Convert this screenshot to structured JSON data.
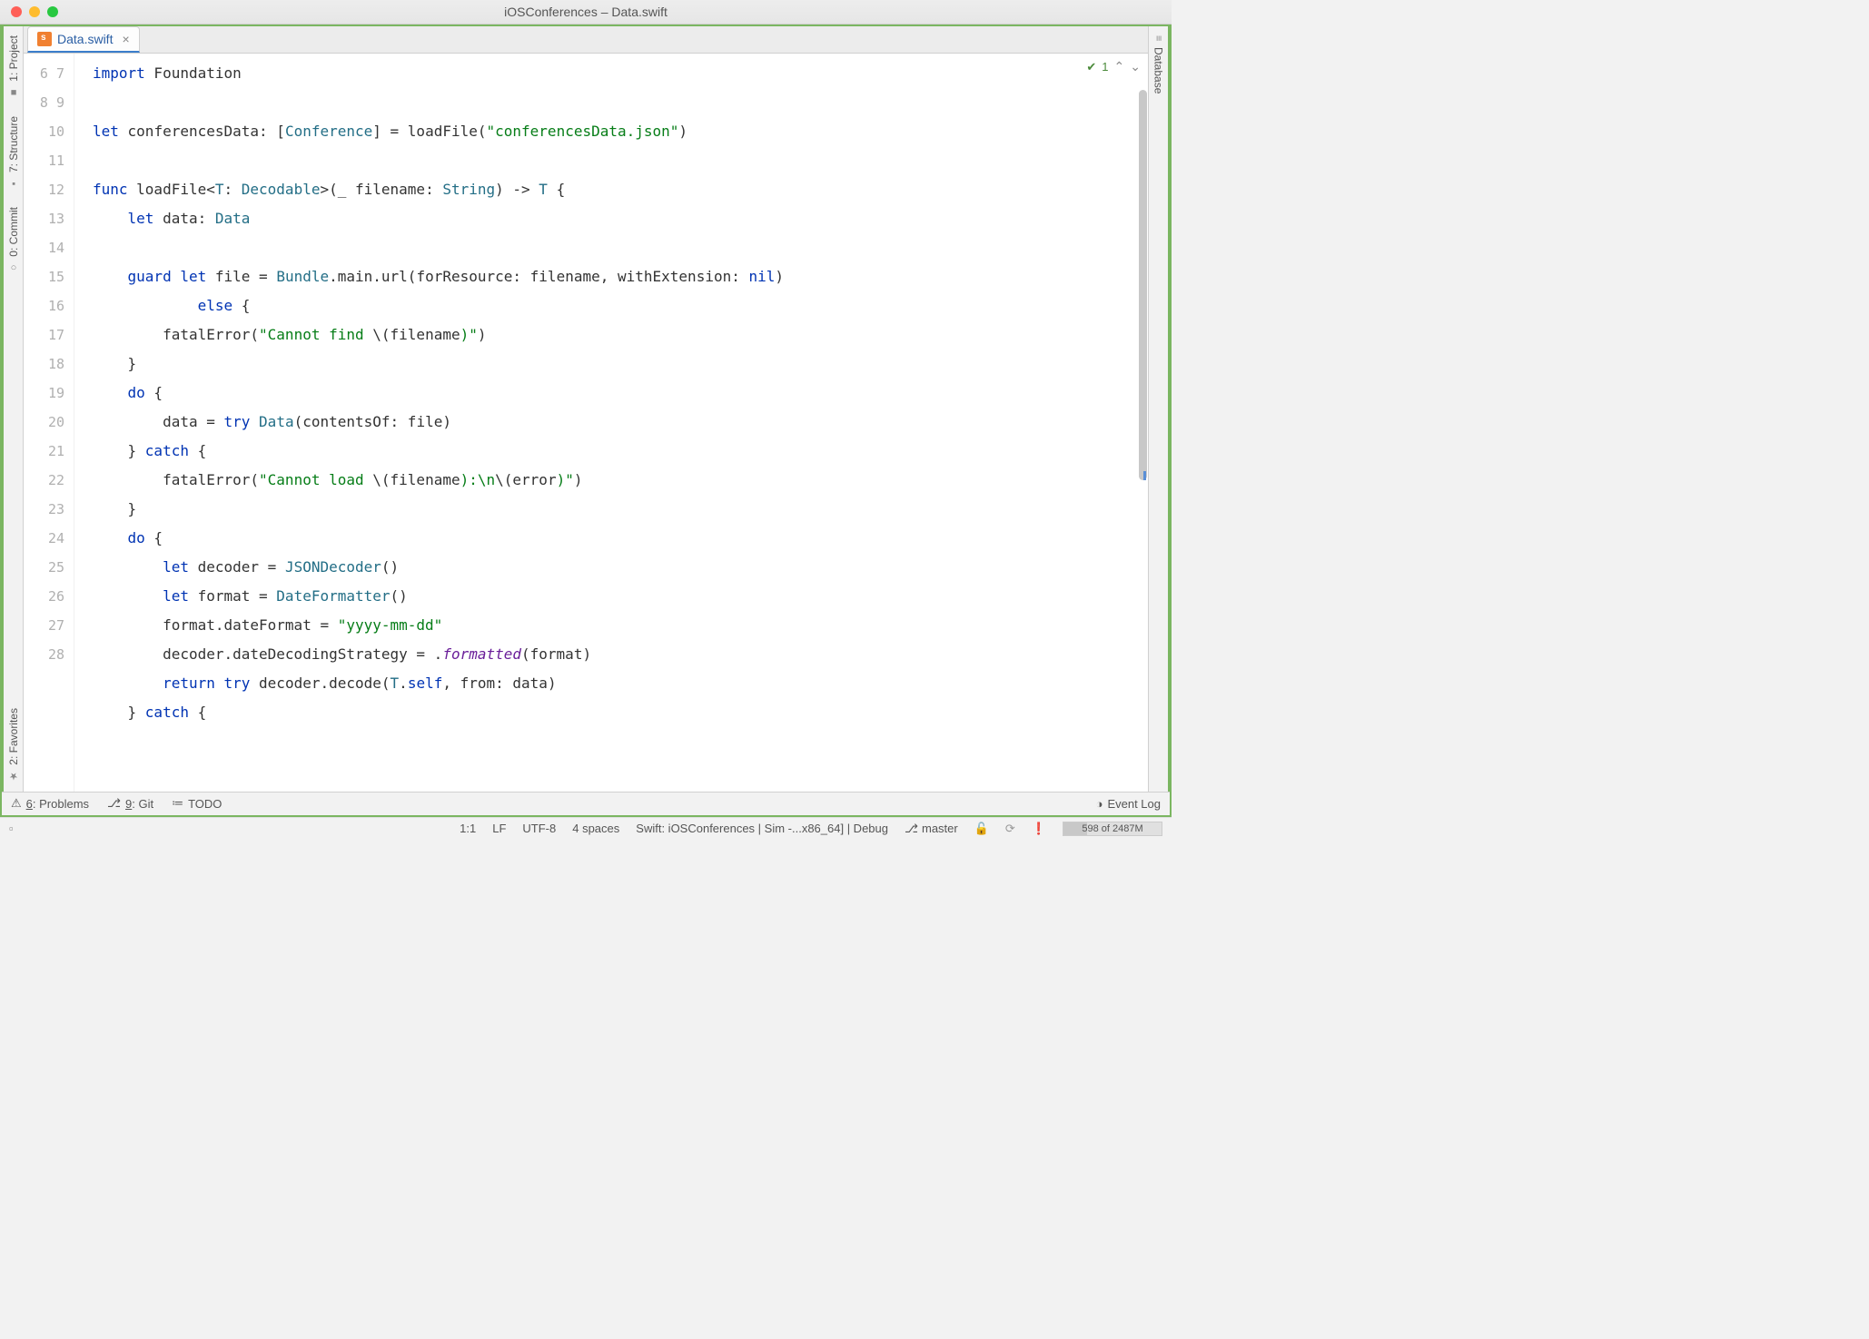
{
  "window": {
    "title": "iOSConferences – Data.swift"
  },
  "left_strip": {
    "project": "1: Project",
    "structure": "7: Structure",
    "commit": "0: Commit",
    "favorites": "2: Favorites"
  },
  "right_strip": {
    "database": "Database"
  },
  "tab": {
    "filename": "Data.swift"
  },
  "gutter": {
    "start": 6,
    "end": 28
  },
  "code": {
    "l6a": "import",
    "l6b": " Foundation",
    "l8a": "let",
    "l8b": " conferencesData: [",
    "l8c": "Conference",
    "l8d": "] = loadFile(",
    "l8e": "\"conferencesData.json\"",
    "l8f": ")",
    "l10a": "func",
    "l10b": " loadFile<",
    "l10c": "T",
    "l10d": ": ",
    "l10e": "Decodable",
    "l10f": ">(_ filename: ",
    "l10g": "String",
    "l10h": ") -> ",
    "l10i": "T",
    "l10j": " {",
    "l11a": "    let",
    "l11b": " data: ",
    "l11c": "Data",
    "l13a": "    guard",
    "l13b": " ",
    "l13c": "let",
    "l13d": " file = ",
    "l13e": "Bundle",
    "l13f": ".main.url(forResource: filename, withExtension: ",
    "l13g": "nil",
    "l13h": ")",
    "l14a": "            else",
    "l14b": " {",
    "l15a": "        fatalError(",
    "l15b": "\"Cannot find ",
    "l15c": "\\(",
    "l15d": "filename",
    "l15e": ")\"",
    "l15f": ")",
    "l16a": "    }",
    "l17a": "    do",
    "l17b": " {",
    "l18a": "        data = ",
    "l18b": "try",
    "l18c": " ",
    "l18d": "Data",
    "l18e": "(contentsOf: file)",
    "l19a": "    } ",
    "l19b": "catch",
    "l19c": " {",
    "l20a": "        fatalError(",
    "l20b": "\"Cannot load ",
    "l20c": "\\(",
    "l20d": "filename",
    "l20e": ")",
    "l20f": ":\\n",
    "l20g": "\\(",
    "l20h": "error",
    "l20i": ")\"",
    "l20j": ")",
    "l21a": "    }",
    "l22a": "    do",
    "l22b": " {",
    "l23a": "        let",
    "l23b": " decoder = ",
    "l23c": "JSONDecoder",
    "l23d": "()",
    "l24a": "        let",
    "l24b": " format = ",
    "l24c": "DateFormatter",
    "l24d": "()",
    "l25a": "        format.dateFormat = ",
    "l25b": "\"yyyy-mm-dd\"",
    "l26a": "        decoder.dateDecodingStrategy = .",
    "l26b": "formatted",
    "l26c": "(format)",
    "l27a": "        return",
    "l27b": " ",
    "l27c": "try",
    "l27d": " decoder.decode(",
    "l27e": "T",
    "l27f": ".",
    "l27g": "self",
    "l27h": ", from: data)",
    "l28a": "    } ",
    "l28b": "catch",
    "l28c": " {"
  },
  "inspection": {
    "count": "1"
  },
  "bottom_tools": {
    "problems": "6: Problems",
    "git": "9: Git",
    "todo": "TODO",
    "eventlog": "Event Log"
  },
  "status": {
    "pos": "1:1",
    "linesep": "LF",
    "encoding": "UTF-8",
    "indent": "4 spaces",
    "config": "Swift: iOSConferences | Sim -...x86_64] | Debug",
    "branch": "master",
    "mem": "598 of 2487M"
  }
}
